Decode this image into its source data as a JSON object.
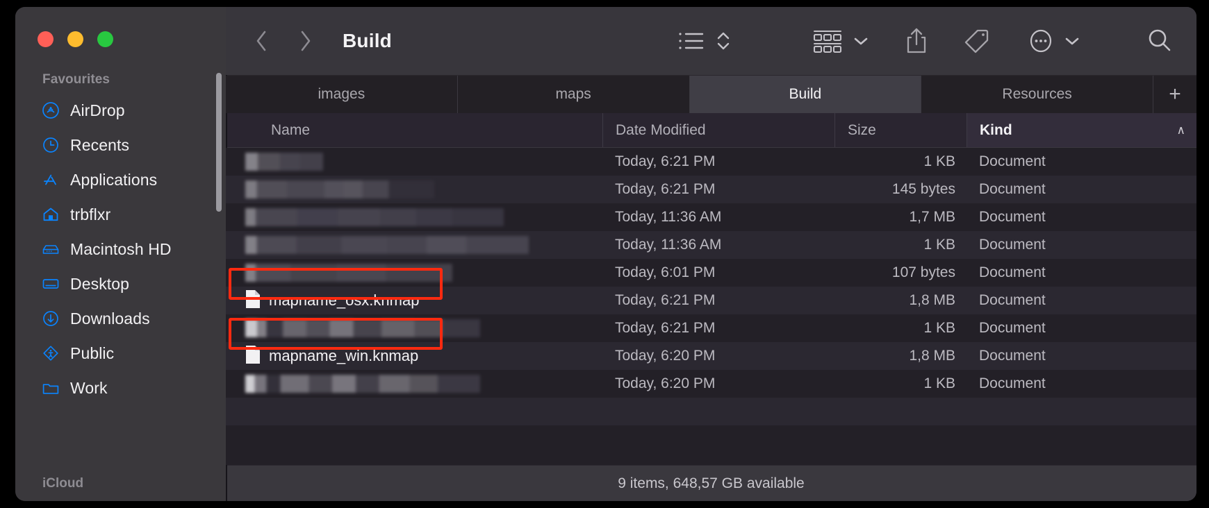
{
  "window": {
    "title": "Build",
    "traffic_lights": [
      "close",
      "minimize",
      "zoom"
    ]
  },
  "toolbar": {
    "back_label": "‹",
    "forward_label": "›",
    "icons": [
      {
        "name": "list-view-icon",
        "label": "List view"
      },
      {
        "name": "sort-order-icon",
        "label": "Sort order"
      },
      {
        "name": "group-view-icon",
        "label": "Group by"
      },
      {
        "name": "group-chevron-icon",
        "label": "Group menu"
      },
      {
        "name": "share-icon",
        "label": "Share"
      },
      {
        "name": "tag-icon",
        "label": "Tags"
      },
      {
        "name": "more-actions-icon",
        "label": "More"
      },
      {
        "name": "more-chevron-icon",
        "label": "More menu"
      },
      {
        "name": "search-icon",
        "label": "Search"
      }
    ]
  },
  "sidebar": {
    "section_title": "Favourites",
    "bottom_section_title": "iCloud",
    "items": [
      {
        "label": "AirDrop",
        "icon": "airdrop-icon"
      },
      {
        "label": "Recents",
        "icon": "clock-icon"
      },
      {
        "label": "Applications",
        "icon": "applications-icon"
      },
      {
        "label": "trbflxr",
        "icon": "home-icon"
      },
      {
        "label": "Macintosh HD",
        "icon": "harddisk-icon"
      },
      {
        "label": "Desktop",
        "icon": "desktop-icon"
      },
      {
        "label": "Downloads",
        "icon": "downloads-icon"
      },
      {
        "label": "Public",
        "icon": "public-folder-icon"
      },
      {
        "label": "Work",
        "icon": "folder-icon"
      }
    ]
  },
  "tabs": {
    "items": [
      {
        "label": "images",
        "active": false
      },
      {
        "label": "maps",
        "active": false
      },
      {
        "label": "Build",
        "active": true
      },
      {
        "label": "Resources",
        "active": false
      }
    ],
    "add_label": "+"
  },
  "columns": {
    "name": "Name",
    "date_modified": "Date Modified",
    "size": "Size",
    "kind": "Kind",
    "sort_arrow": "∧",
    "sorted_by": "Kind"
  },
  "files": [
    {
      "name": "",
      "redacted": true,
      "redact_style": "r1",
      "date": "Today, 6:21 PM",
      "size": "1 KB",
      "kind": "Document"
    },
    {
      "name": "",
      "redacted": true,
      "redact_style": "r2",
      "date": "Today, 6:21 PM",
      "size": "145 bytes",
      "kind": "Document"
    },
    {
      "name": "",
      "redacted": true,
      "redact_style": "r3",
      "date": "Today, 11:36 AM",
      "size": "1,7 MB",
      "kind": "Document"
    },
    {
      "name": "",
      "redacted": true,
      "redact_style": "r4",
      "date": "Today, 11:36 AM",
      "size": "1 KB",
      "kind": "Document"
    },
    {
      "name": "",
      "redacted": true,
      "redact_style": "r5",
      "date": "Today, 6:01 PM",
      "size": "107 bytes",
      "kind": "Document"
    },
    {
      "name": "mapname_osx.knmap",
      "redacted": false,
      "redact_style": "",
      "date": "Today, 6:21 PM",
      "size": "1,8 MB",
      "kind": "Document",
      "highlighted": true
    },
    {
      "name": "",
      "redacted": true,
      "redact_style": "r6",
      "date": "Today, 6:21 PM",
      "size": "1 KB",
      "kind": "Document"
    },
    {
      "name": "mapname_win.knmap",
      "redacted": false,
      "redact_style": "",
      "date": "Today, 6:20 PM",
      "size": "1,8 MB",
      "kind": "Document",
      "highlighted": true
    },
    {
      "name": "",
      "redacted": true,
      "redact_style": "r7",
      "date": "Today, 6:20 PM",
      "size": "1 KB",
      "kind": "Document"
    }
  ],
  "status": {
    "text": "9 items, 648,57 GB available"
  },
  "colors": {
    "accent_blue": "#0a84ff",
    "highlight_red": "#ff2a10",
    "sidebar_bg": "#3a383c",
    "toolbar_bg": "#38363c",
    "list_bg": "#232027",
    "row_alt_bg": "#2b2831"
  }
}
